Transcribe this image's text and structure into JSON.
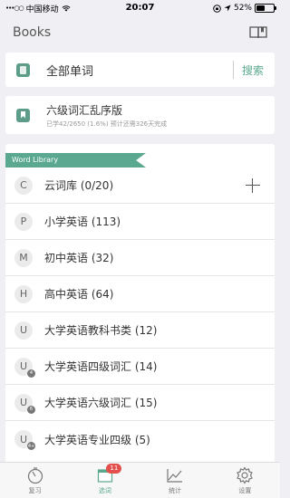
{
  "statusbar": {
    "signal": "•••○○",
    "carrier": "中国移动",
    "time": "20:07",
    "battery": "52%",
    "battery_level": 0.52
  },
  "header": {
    "title": "Books"
  },
  "all_words": {
    "label": "全部单词",
    "search": "搜索"
  },
  "current_book": {
    "title": "六级词汇乱序版",
    "progress": "已学42/2650 (1.6%) 预计还需326天完成"
  },
  "library": {
    "ribbon": "Word Library",
    "items": [
      {
        "letter": "C",
        "label": "云词库 (0/20)",
        "badge": ""
      },
      {
        "letter": "P",
        "label": "小学英语 (113)",
        "badge": ""
      },
      {
        "letter": "M",
        "label": "初中英语 (32)",
        "badge": ""
      },
      {
        "letter": "H",
        "label": "高中英语 (64)",
        "badge": ""
      },
      {
        "letter": "U",
        "label": "大学英语教科书类 (12)",
        "badge": ""
      },
      {
        "letter": "U",
        "label": "大学英语四级词汇 (14)",
        "badge": "4"
      },
      {
        "letter": "U",
        "label": "大学英语六级词汇 (15)",
        "badge": "6"
      },
      {
        "letter": "U",
        "label": "大学英语专业四级 (5)",
        "badge": "4+"
      }
    ]
  },
  "tabbar": {
    "tabs": [
      {
        "label": "复习"
      },
      {
        "label": "选词",
        "badge": "11"
      },
      {
        "label": "统计"
      },
      {
        "label": "设置"
      }
    ]
  },
  "colors": {
    "accent": "#5aa88f",
    "badge": "#e3504b"
  }
}
